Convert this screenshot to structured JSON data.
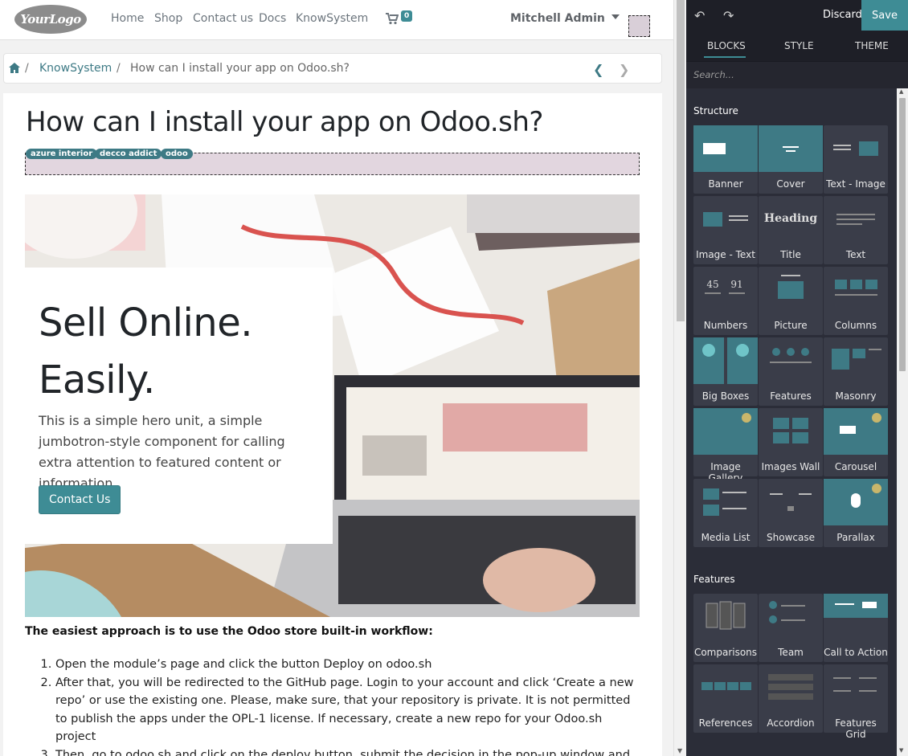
{
  "nav": {
    "logo": "YourLogo",
    "links": [
      "Home",
      "Shop",
      "Contact us",
      "Docs",
      "KnowSystem"
    ],
    "cart_count": "0",
    "user": "Mitchell Admin"
  },
  "breadcrumb": {
    "items": [
      "KnowSystem",
      "How can I install your app on Odoo.sh?"
    ]
  },
  "article": {
    "title": "How can I install your app on Odoo.sh?",
    "tags": [
      "azure interior",
      "decco addict",
      "odoo"
    ],
    "hero": {
      "title": "Sell Online. Easily.",
      "text": "This is a simple hero unit, a simple jumbotron-style component for calling extra attention to featured content or information.",
      "button": "Contact Us"
    },
    "steps_heading": "The easiest approach is to use the Odoo store built-in workflow:",
    "steps": [
      "Open the module’s page and click the button Deploy on odoo.sh",
      "After that, you will be redirected to the GitHub page. Login to your account and click ‘Create a new repo’ or use the existing one. Please, make sure, that your repository is private. It is not permitted to publish the apps under the OPL-1 license. If necessary, create a new repo for your Odoo.sh project",
      "Then, go to odoo.sh and click on the deploy button, submit the decision in the pop-up window and click ‘Continue’. The action will trigger the installation process."
    ]
  },
  "editor": {
    "discard": "Discard",
    "save": "Save",
    "tabs": [
      "BLOCKS",
      "STYLE",
      "THEME"
    ],
    "active_tab": "BLOCKS",
    "search_placeholder": "Search...",
    "sections": [
      {
        "title": "Structure",
        "blocks": [
          "Banner",
          "Cover",
          "Text - Image",
          "Image - Text",
          "Title",
          "Text",
          "Numbers",
          "Picture",
          "Columns",
          "Big Boxes",
          "Features",
          "Masonry",
          "Image Gallery",
          "Images Wall",
          "Carousel",
          "Media List",
          "Showcase",
          "Parallax"
        ]
      },
      {
        "title": "Features",
        "blocks": [
          "Comparisons",
          "Team",
          "Call to Action",
          "References",
          "Accordion",
          "Features Grid"
        ]
      }
    ],
    "accent_color": "#3e8c95"
  }
}
